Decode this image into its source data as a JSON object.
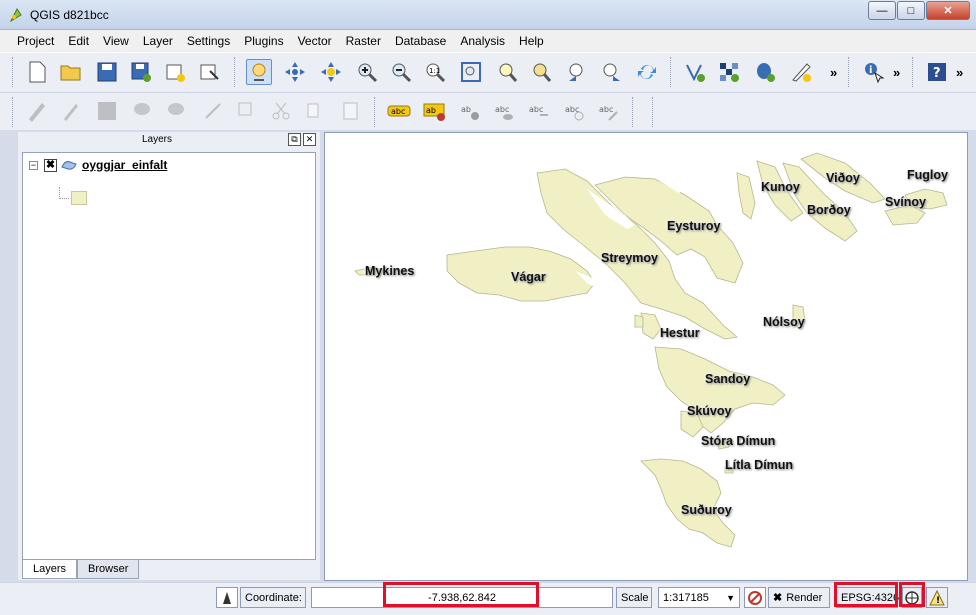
{
  "window": {
    "title": "QGIS d821bcc"
  },
  "menu": [
    "Project",
    "Edit",
    "View",
    "Layer",
    "Settings",
    "Plugins",
    "Vector",
    "Raster",
    "Database",
    "Analysis",
    "Help"
  ],
  "layers_panel": {
    "title": "Layers",
    "layer_name": "oyggjar_einfalt",
    "tabs": [
      "Layers",
      "Browser"
    ],
    "fill_color": "#f0f0c4"
  },
  "map": {
    "labels": [
      {
        "text": "Fugloy"
      },
      {
        "text": "Viðoy"
      },
      {
        "text": "Kunoy"
      },
      {
        "text": "Svínoy"
      },
      {
        "text": "Borðoy"
      },
      {
        "text": "Eysturoy"
      },
      {
        "text": "Streymoy"
      },
      {
        "text": "Mykines"
      },
      {
        "text": "Vágar"
      },
      {
        "text": "Nólsoy"
      },
      {
        "text": "Hestur"
      },
      {
        "text": "Sandoy"
      },
      {
        "text": "Skúvoy"
      },
      {
        "text": "Stóra Dímun"
      },
      {
        "text": "Lítla Dímun"
      },
      {
        "text": "Suðuroy"
      }
    ]
  },
  "status": {
    "coordinate_label": "Coordinate:",
    "coordinate_value": "-7.938,62.842",
    "scale_label": "Scale",
    "scale_value": "1:317185",
    "render_label": "Render",
    "crs": "EPSG:4326",
    "highlight_color": "#e0102a"
  }
}
